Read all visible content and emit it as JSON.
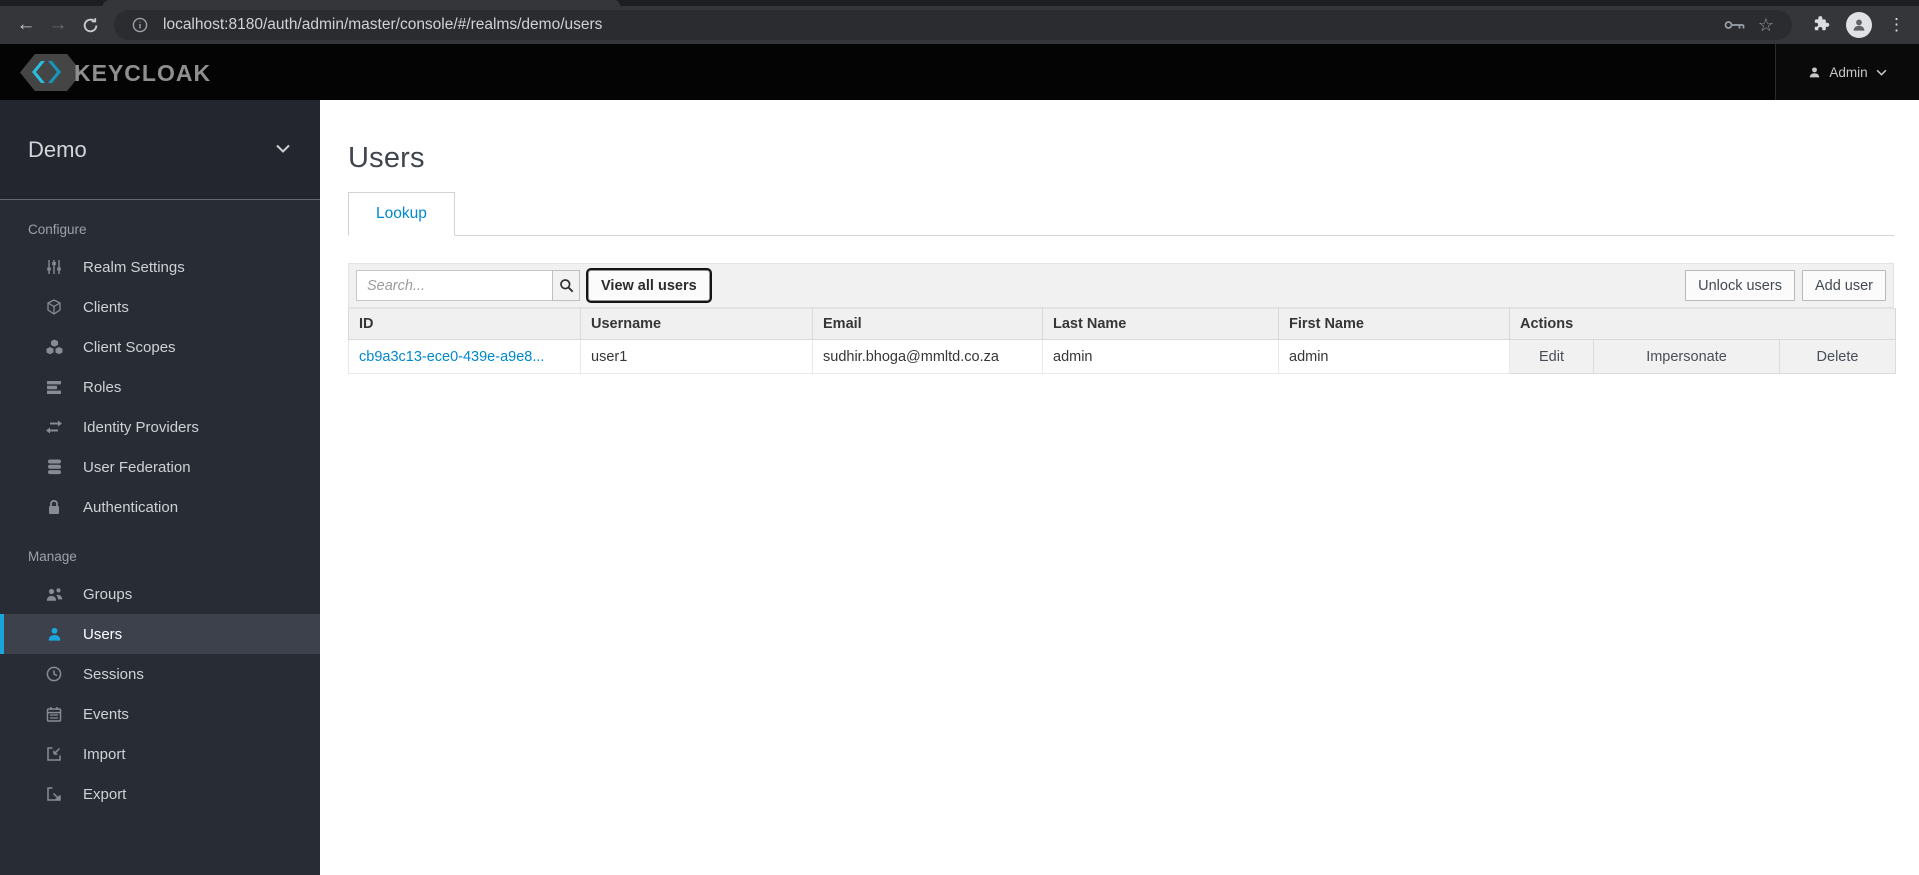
{
  "browser": {
    "url": "localhost:8180/auth/admin/master/console/#/realms/demo/users",
    "icons": [
      "back-arrow",
      "forward-arrow",
      "reload",
      "info-circle",
      "key",
      "star",
      "puzzle-extension",
      "profile-avatar",
      "kebab-menu"
    ]
  },
  "header": {
    "logo_text": "KEYCLOAK",
    "user_menu_label": "Admin"
  },
  "sidebar": {
    "realm": "Demo",
    "sections": [
      {
        "label": "Configure",
        "items": [
          {
            "label": "Realm Settings",
            "icon": "sliders-icon",
            "active": false
          },
          {
            "label": "Clients",
            "icon": "cube-icon",
            "active": false
          },
          {
            "label": "Client Scopes",
            "icon": "cubes-icon",
            "active": false
          },
          {
            "label": "Roles",
            "icon": "list-rows-icon",
            "active": false
          },
          {
            "label": "Identity Providers",
            "icon": "exchange-arrows-icon",
            "active": false
          },
          {
            "label": "User Federation",
            "icon": "database-icon",
            "active": false
          },
          {
            "label": "Authentication",
            "icon": "lock-icon",
            "active": false
          }
        ]
      },
      {
        "label": "Manage",
        "items": [
          {
            "label": "Groups",
            "icon": "people-icon",
            "active": false
          },
          {
            "label": "Users",
            "icon": "person-icon",
            "active": true
          },
          {
            "label": "Sessions",
            "icon": "clock-icon",
            "active": false
          },
          {
            "label": "Events",
            "icon": "calendar-icon",
            "active": false
          },
          {
            "label": "Import",
            "icon": "arrow-into-box-icon",
            "active": false
          },
          {
            "label": "Export",
            "icon": "arrow-out-of-box-icon",
            "active": false
          }
        ]
      }
    ]
  },
  "main": {
    "title": "Users",
    "tabs": [
      {
        "label": "Lookup",
        "active": true
      }
    ],
    "toolbar": {
      "search_placeholder": "Search...",
      "view_all_label": "View all users",
      "unlock_label": "Unlock users",
      "add_user_label": "Add user"
    },
    "table": {
      "columns": [
        "ID",
        "Username",
        "Email",
        "Last Name",
        "First Name",
        "Actions"
      ],
      "rows": [
        {
          "id": "cb9a3c13-ece0-439e-a9e8...",
          "username": "user1",
          "email": "sudhir.bhoga@mmltd.co.za",
          "last_name": "admin",
          "first_name": "admin",
          "actions": [
            "Edit",
            "Impersonate",
            "Delete"
          ]
        }
      ]
    }
  },
  "colors": {
    "accent_blue": "#0088ce",
    "selected_item_blue": "#1ca8dd",
    "header_bg": "#040404",
    "sidebar_bg": "#282c34"
  }
}
